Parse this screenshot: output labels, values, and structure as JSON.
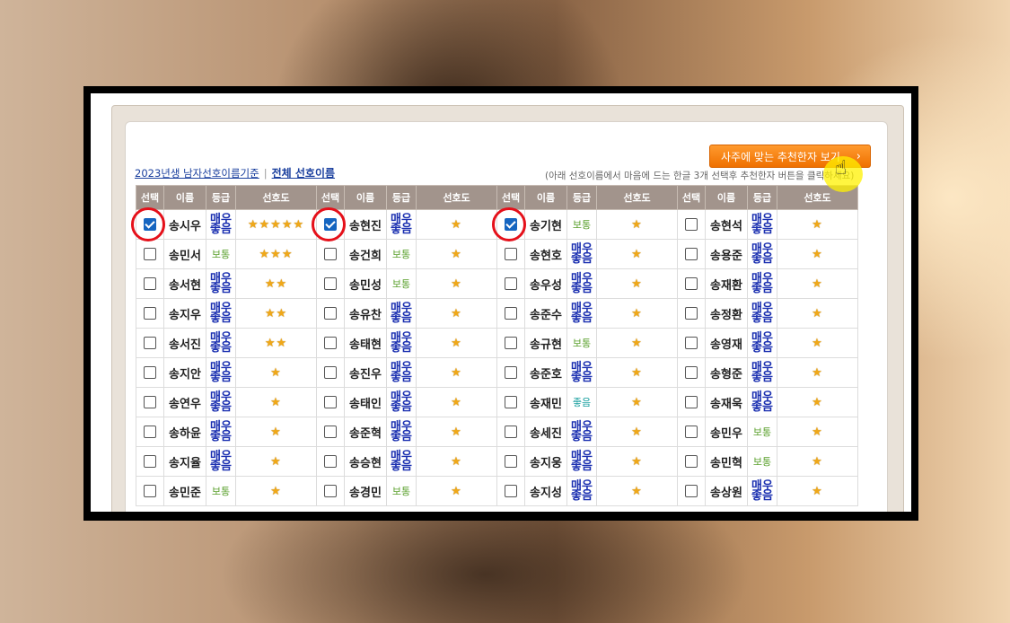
{
  "header": {
    "recommend_button": "사주에 맞는 추천한자 보기",
    "arrow": "›",
    "link_2023": "2023년생 남자선호이름기준",
    "separator": "|",
    "link_all": "전체 선호이름",
    "hint": "(아래 선호이름에서 마음에 드는 한글 3개 선택후 추천한자 버튼을 클릭하세요)"
  },
  "columns": [
    "선택",
    "이름",
    "등급",
    "선호도"
  ],
  "grade_labels": {
    "very_good": "매우\n좋음",
    "normal": "보통",
    "good": "좋음"
  },
  "star_char": "★",
  "groups": [
    [
      {
        "name": "송시우",
        "grade": "very_good",
        "stars": 5,
        "checked": true
      },
      {
        "name": "송민서",
        "grade": "normal",
        "stars": 3,
        "checked": false
      },
      {
        "name": "송서현",
        "grade": "very_good",
        "stars": 2,
        "checked": false
      },
      {
        "name": "송지우",
        "grade": "very_good",
        "stars": 2,
        "checked": false
      },
      {
        "name": "송서진",
        "grade": "very_good",
        "stars": 2,
        "checked": false
      },
      {
        "name": "송지안",
        "grade": "very_good",
        "stars": 1,
        "checked": false
      },
      {
        "name": "송연우",
        "grade": "very_good",
        "stars": 1,
        "checked": false
      },
      {
        "name": "송하윤",
        "grade": "very_good",
        "stars": 1,
        "checked": false
      },
      {
        "name": "송지율",
        "grade": "very_good",
        "stars": 1,
        "checked": false
      },
      {
        "name": "송민준",
        "grade": "normal",
        "stars": 1,
        "checked": false
      }
    ],
    [
      {
        "name": "송현진",
        "grade": "very_good",
        "stars": 1,
        "checked": true
      },
      {
        "name": "송건희",
        "grade": "normal",
        "stars": 1,
        "checked": false
      },
      {
        "name": "송민성",
        "grade": "normal",
        "stars": 1,
        "checked": false
      },
      {
        "name": "송유찬",
        "grade": "very_good",
        "stars": 1,
        "checked": false
      },
      {
        "name": "송태현",
        "grade": "very_good",
        "stars": 1,
        "checked": false
      },
      {
        "name": "송진우",
        "grade": "very_good",
        "stars": 1,
        "checked": false
      },
      {
        "name": "송태인",
        "grade": "very_good",
        "stars": 1,
        "checked": false
      },
      {
        "name": "송준혁",
        "grade": "very_good",
        "stars": 1,
        "checked": false
      },
      {
        "name": "송승현",
        "grade": "very_good",
        "stars": 1,
        "checked": false
      },
      {
        "name": "송경민",
        "grade": "normal",
        "stars": 1,
        "checked": false
      }
    ],
    [
      {
        "name": "송기현",
        "grade": "normal",
        "stars": 1,
        "checked": true
      },
      {
        "name": "송현호",
        "grade": "very_good",
        "stars": 1,
        "checked": false
      },
      {
        "name": "송우성",
        "grade": "very_good",
        "stars": 1,
        "checked": false
      },
      {
        "name": "송준수",
        "grade": "very_good",
        "stars": 1,
        "checked": false
      },
      {
        "name": "송규현",
        "grade": "normal",
        "stars": 1,
        "checked": false
      },
      {
        "name": "송준호",
        "grade": "very_good",
        "stars": 1,
        "checked": false
      },
      {
        "name": "송재민",
        "grade": "good",
        "stars": 1,
        "checked": false
      },
      {
        "name": "송세진",
        "grade": "very_good",
        "stars": 1,
        "checked": false
      },
      {
        "name": "송지웅",
        "grade": "very_good",
        "stars": 1,
        "checked": false
      },
      {
        "name": "송지성",
        "grade": "very_good",
        "stars": 1,
        "checked": false
      }
    ],
    [
      {
        "name": "송현석",
        "grade": "very_good",
        "stars": 1,
        "checked": false
      },
      {
        "name": "송용준",
        "grade": "very_good",
        "stars": 1,
        "checked": false
      },
      {
        "name": "송재환",
        "grade": "very_good",
        "stars": 1,
        "checked": false
      },
      {
        "name": "송정환",
        "grade": "very_good",
        "stars": 1,
        "checked": false
      },
      {
        "name": "송영재",
        "grade": "very_good",
        "stars": 1,
        "checked": false
      },
      {
        "name": "송형준",
        "grade": "very_good",
        "stars": 1,
        "checked": false
      },
      {
        "name": "송재욱",
        "grade": "very_good",
        "stars": 1,
        "checked": false
      },
      {
        "name": "송민우",
        "grade": "normal",
        "stars": 1,
        "checked": false
      },
      {
        "name": "송민혁",
        "grade": "normal",
        "stars": 1,
        "checked": false
      },
      {
        "name": "송상원",
        "grade": "very_good",
        "stars": 1,
        "checked": false
      }
    ]
  ]
}
